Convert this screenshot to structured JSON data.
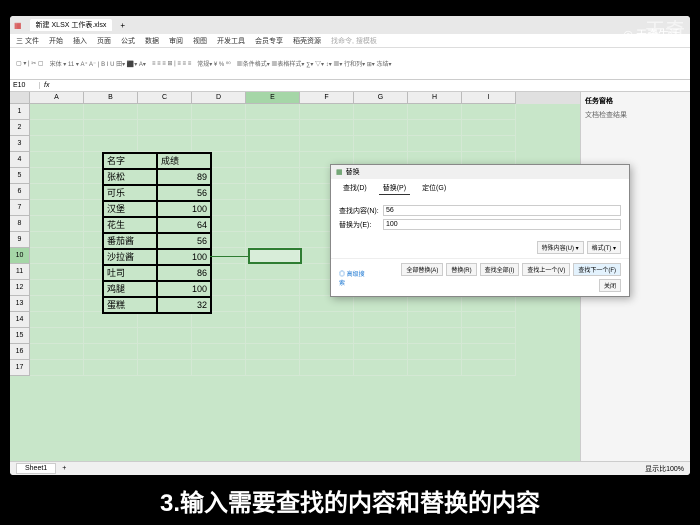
{
  "watermark": {
    "brand": "天奇生活",
    "big": "天奇",
    "icon": "Q"
  },
  "window": {
    "doc_tab": "新建 XLSX 工作表.xlsx",
    "menus": [
      "开始",
      "插入",
      "页面",
      "公式",
      "数据",
      "审阅",
      "视图",
      "开发工具",
      "会员专享",
      "稻壳资源"
    ],
    "search_placeholder": "找命令, 搜模板"
  },
  "formula": {
    "cell": "E10",
    "fx": "fx"
  },
  "columns": [
    "A",
    "B",
    "C",
    "D",
    "E",
    "F",
    "G",
    "H",
    "I"
  ],
  "rows": [
    "1",
    "2",
    "3",
    "4",
    "5",
    "6",
    "7",
    "8",
    "9",
    "10",
    "11",
    "12",
    "13",
    "14",
    "15",
    "16",
    "17"
  ],
  "table": {
    "headers": {
      "name": "名字",
      "score": "成绩"
    },
    "rows": [
      {
        "name": "张松",
        "score": "89"
      },
      {
        "name": "可乐",
        "score": "56"
      },
      {
        "name": "汉堡",
        "score": "100"
      },
      {
        "name": "花生",
        "score": "64"
      },
      {
        "name": "番茄酱",
        "score": "56"
      },
      {
        "name": "沙拉酱",
        "score": "100"
      },
      {
        "name": "吐司",
        "score": "86"
      },
      {
        "name": "鸡腿",
        "score": "100"
      },
      {
        "name": "蛋糕",
        "score": "32"
      }
    ]
  },
  "dialog": {
    "title": "替换",
    "tabs": {
      "find": "查找(D)",
      "replace": "替换(P)",
      "goto": "定位(G)"
    },
    "find_label": "查找内容(N):",
    "find_value": "56",
    "replace_label": "替换为(E):",
    "replace_value": "100",
    "options_link": "◎ 高级搜索",
    "btn_options": "特殊内容(U) ▾",
    "btn_format": "格式(T) ▾",
    "btn_replace_all": "全部替换(A)",
    "btn_replace": "替换(R)",
    "btn_find_all": "查找全部(I)",
    "btn_find_prev": "查找上一个(V)",
    "btn_find_next": "查找下一个(F)",
    "btn_close": "关闭"
  },
  "side_panel": {
    "title": "任务窗格",
    "subtitle": "文档检查结果"
  },
  "sheet_tab": "Sheet1",
  "status": {
    "zoom": "显示比100%"
  },
  "caption": "3.输入需要查找的内容和替换的内容"
}
